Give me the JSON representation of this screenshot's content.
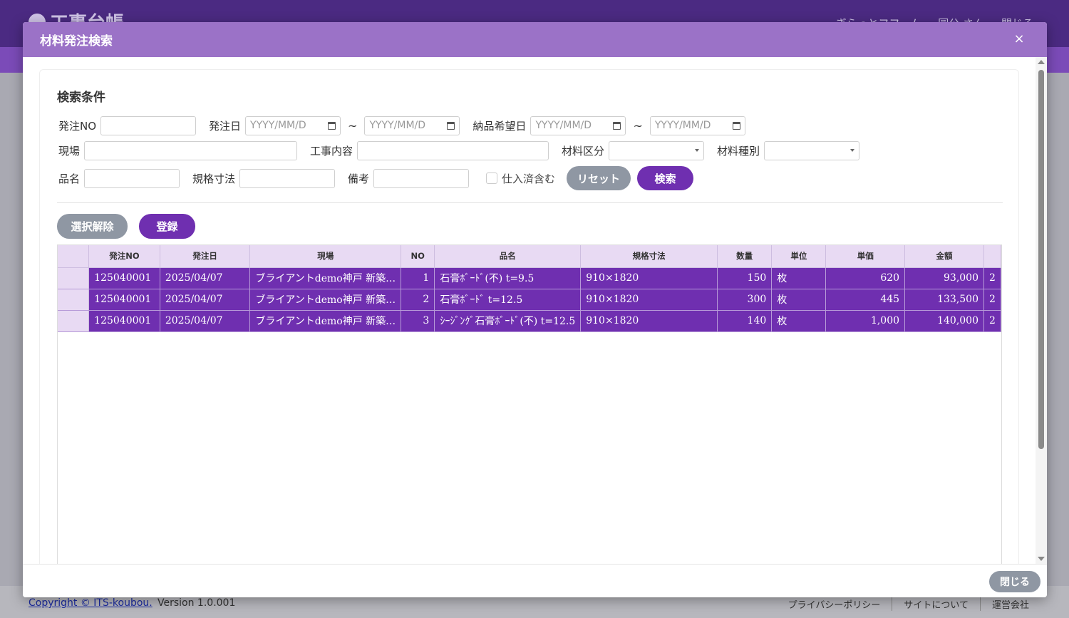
{
  "app": {
    "title": "工事台帳",
    "company": "ぎらっとフフーム",
    "user": "圓公 さん",
    "logout": "閉じる"
  },
  "footer": {
    "copyright": "Copyright © ITS-koubou.",
    "version": "Version 1.0.001",
    "links": [
      "プライバシーポリシー",
      "サイトについて",
      "運営会社"
    ]
  },
  "modal": {
    "title": "材料発注検索",
    "close_icon": "×",
    "section_title": "検索条件",
    "filters": {
      "order_no_label": "発注NO",
      "order_date_label": "発注日",
      "date_placeholder": "YYYY/MM/D",
      "tilde": "~",
      "delivery_date_label": "納品希望日",
      "site_label": "現場",
      "work_label": "工事内容",
      "material_cat_label": "材料区分",
      "material_type_label": "材料種別",
      "item_label": "品名",
      "spec_label": "規格寸法",
      "note_label": "備考",
      "include_purchased_label": "仕入済含む"
    },
    "buttons": {
      "reset": "リセット",
      "search": "検索",
      "deselect": "選択解除",
      "register": "登録",
      "close": "閉じる"
    },
    "table": {
      "columns": [
        "発注NO",
        "発注日",
        "現場",
        "NO",
        "品名",
        "規格寸法",
        "数量",
        "単位",
        "単価",
        "金額"
      ],
      "rows": [
        {
          "order_no": "125040001",
          "date": "2025/04/07",
          "site": "ブライアントdemo神戸 新築…",
          "no": "1",
          "item": "石膏ﾎﾞｰﾄﾞ(不) t=9.5",
          "spec": "910×1820",
          "qty": "150",
          "unit": "枚",
          "price": "620",
          "amount": "93,000",
          "extra": "2"
        },
        {
          "order_no": "125040001",
          "date": "2025/04/07",
          "site": "ブライアントdemo神戸 新築…",
          "no": "2",
          "item": "石膏ﾎﾞｰﾄﾞ t=12.5",
          "spec": "910×1820",
          "qty": "300",
          "unit": "枚",
          "price": "445",
          "amount": "133,500",
          "extra": "2"
        },
        {
          "order_no": "125040001",
          "date": "2025/04/07",
          "site": "ブライアントdemo神戸 新築…",
          "no": "3",
          "item": "ｼｰｼﾞﾝｸﾞ石膏ﾎﾞｰﾄﾞ(不) t=12.5",
          "spec": "910×1820",
          "qty": "140",
          "unit": "枚",
          "price": "1,000",
          "amount": "140,000",
          "extra": "2"
        }
      ]
    }
  },
  "colors": {
    "header": "#4b2a82",
    "modal_header": "#9b72c7",
    "accent": "#6f2fb0",
    "table_header": "#e8daf3",
    "gray_button": "#8f97a3"
  }
}
